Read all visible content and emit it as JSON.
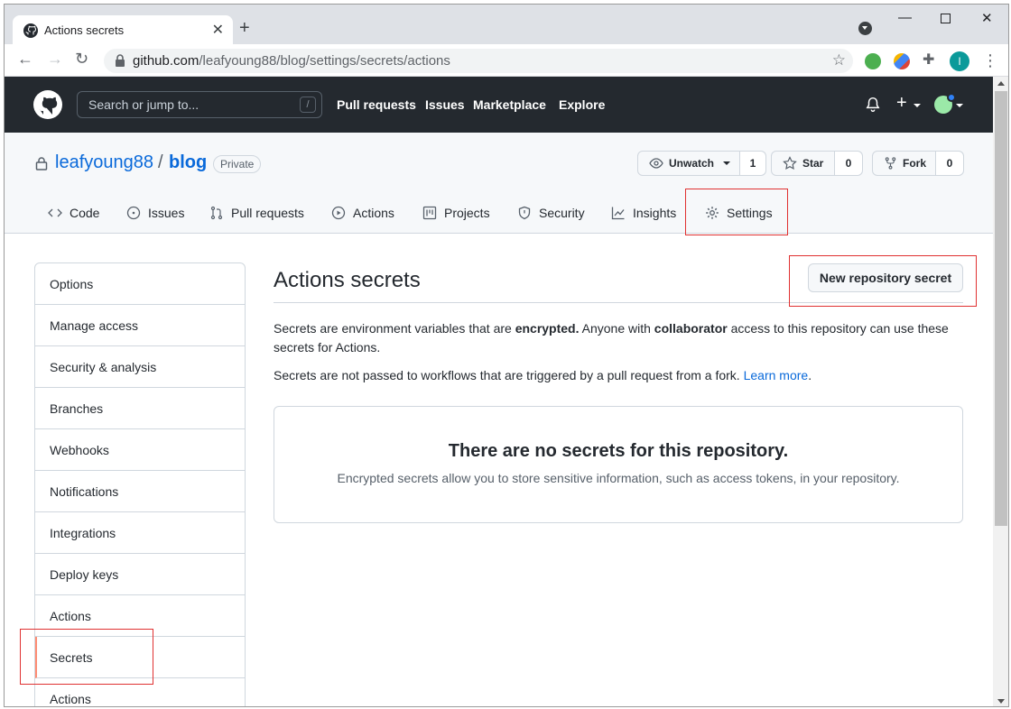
{
  "browser": {
    "tab_title": "Actions secrets",
    "url_host": "github.com",
    "url_path": "/leafyoung88/blog/settings/secrets/actions",
    "profile_initial": "I"
  },
  "github_header": {
    "search_placeholder": "Search or jump to...",
    "search_shortcut": "/",
    "nav": [
      "Pull requests",
      "Issues",
      "Marketplace",
      "Explore"
    ]
  },
  "repo": {
    "owner": "leafyoung88",
    "separator": "/",
    "name": "blog",
    "visibility": "Private",
    "unwatch_label": "Unwatch",
    "watch_count": "1",
    "star_label": "Star",
    "star_count": "0",
    "fork_label": "Fork",
    "fork_count": "0",
    "tabs": [
      "Code",
      "Issues",
      "Pull requests",
      "Actions",
      "Projects",
      "Security",
      "Insights",
      "Settings"
    ]
  },
  "sidebar": {
    "items": [
      "Options",
      "Manage access",
      "Security & analysis",
      "Branches",
      "Webhooks",
      "Notifications",
      "Integrations",
      "Deploy keys",
      "Actions",
      "Secrets",
      "Actions"
    ],
    "active_index": 9
  },
  "main": {
    "title": "Actions secrets",
    "new_button": "New repository secret",
    "p1_a": "Secrets are environment variables that are ",
    "p1_b": "encrypted.",
    "p1_c": " Anyone with ",
    "p1_d": "collaborator",
    "p1_e": " access to this repository can use these secrets for Actions.",
    "p2": "Secrets are not passed to workflows that are triggered by a pull request from a fork. ",
    "p2_link": "Learn more",
    "p2_end": ".",
    "blank_title": "There are no secrets for this repository.",
    "blank_text": "Encrypted secrets allow you to store sensitive information, such as access tokens, in your repository."
  },
  "colors": {
    "header_bg": "#24292f",
    "link": "#0969da",
    "active_marker": "#fd8c73",
    "annotation_red": "#e03131"
  }
}
